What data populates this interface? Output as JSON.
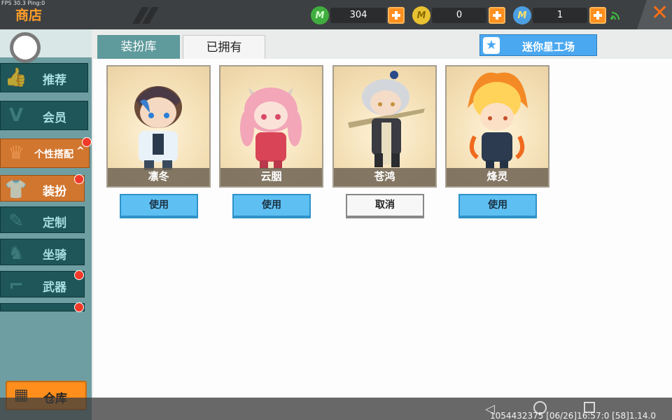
{
  "header": {
    "fps_text": "FPS 30.3  Ping:0",
    "title": "商店",
    "currencies": [
      {
        "icon": "mini-bean-icon",
        "value": "304",
        "color": "#3fae3f"
      },
      {
        "icon": "mini-coin-icon",
        "value": "0",
        "color": "#e9c232"
      },
      {
        "icon": "mini-star-coin-icon",
        "value": "1",
        "color": "#4d9fe3"
      }
    ],
    "close_symbol": "✕"
  },
  "sidebar": {
    "items": [
      {
        "label": "推荐",
        "icon": "thumbs-up-icon"
      },
      {
        "label": "会员",
        "icon": "vip-icon"
      },
      {
        "label": "个性搭配",
        "icon": "trophy-icon",
        "expand_symbol": "^"
      },
      {
        "label": "装扮",
        "icon": "outfit-icon"
      },
      {
        "label": "定制",
        "icon": "pencil-icon"
      },
      {
        "label": "坐骑",
        "icon": "mount-icon"
      },
      {
        "label": "武器",
        "icon": "gun-icon"
      }
    ],
    "warehouse_label": "仓库"
  },
  "tabs": [
    {
      "label": "装扮库",
      "active": false
    },
    {
      "label": "已拥有",
      "active": true
    }
  ],
  "workshop_button": "迷你星工场",
  "skins": [
    {
      "name": "凛冬",
      "action": "使用"
    },
    {
      "name": "云胭",
      "action": "使用"
    },
    {
      "name": "苍鸿",
      "action": "取消"
    },
    {
      "name": "烽灵",
      "action": "使用"
    }
  ],
  "footer": {
    "debug_text": "1054432375  [06/26]16:57:0  [58]1.14.0"
  },
  "colors": {
    "accent_orange": "#ff8e1d",
    "use_button": "#5ec0f2",
    "sidebar_teal": "#1e5659"
  }
}
